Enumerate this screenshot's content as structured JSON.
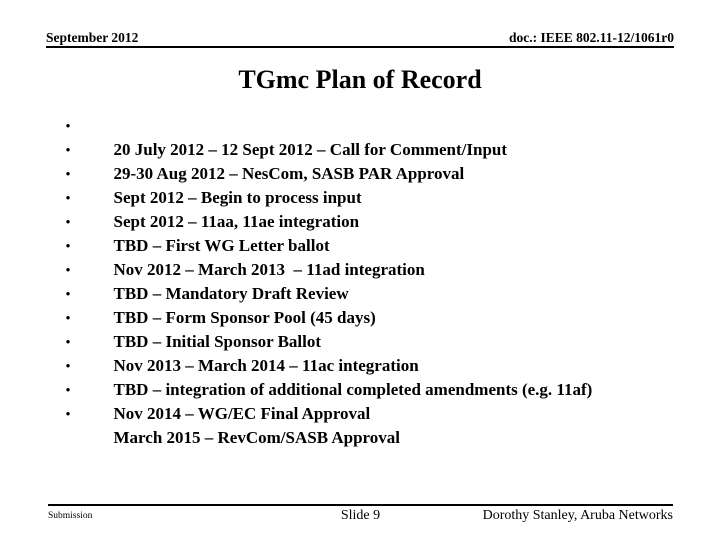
{
  "slide": {
    "header": {
      "date": "September 2012",
      "doc_number": "doc.: IEEE 802.11-12/1061r0"
    },
    "title": "TGmc Plan of Record",
    "bullet_marker": "•",
    "bullets": [
      "20 July 2012 – 12 Sept 2012 – Call for Comment/Input",
      "29-30 Aug 2012 – NesCom, SASB PAR Approval",
      "Sept 2012 – Begin to process input",
      "Sept 2012 – 11aa, 11ae integration",
      "TBD – First WG Letter ballot",
      "Nov 2012 – March 2013  – 11ad integration",
      "TBD – Mandatory Draft Review",
      "TBD – Form Sponsor Pool (45 days)",
      "TBD – Initial Sponsor Ballot",
      "Nov 2013 – March 2014 – 11ac integration",
      "TBD – integration of additional completed amendments (e.g. 11af)",
      "Nov 2014 – WG/EC Final Approval",
      "March 2015 – RevCom/SASB Approval"
    ],
    "footer": {
      "left": "Submission",
      "slide_number": "Slide 9",
      "right": "Dorothy Stanley, Aruba Networks"
    },
    "colors": {
      "text": "#000000",
      "background": "#ffffff",
      "rule": "#000000"
    }
  }
}
